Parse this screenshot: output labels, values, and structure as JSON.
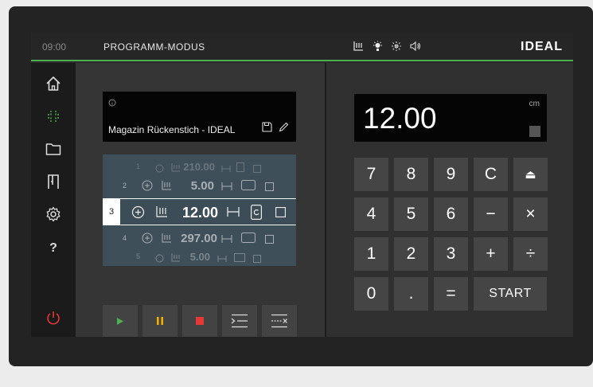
{
  "header": {
    "time": "09:00",
    "mode": "PROGRAMM-MODUS",
    "logo": "IDEAL"
  },
  "status_icons": [
    "cutting-table-icon",
    "light-icon",
    "air-table-icon",
    "sound-icon"
  ],
  "sidebar": {
    "items": [
      "home-icon",
      "program-mode-icon",
      "folder-icon",
      "manual-mode-icon",
      "settings-icon"
    ],
    "help": "?",
    "power": "power-icon"
  },
  "program": {
    "name": "Magazin Rückenstich - IDEAL"
  },
  "steps": [
    {
      "num": "1",
      "value": "210.00"
    },
    {
      "num": "2",
      "value": "5.00"
    },
    {
      "num": "3",
      "value": "12.00",
      "selected": true
    },
    {
      "num": "4",
      "value": "297.00"
    },
    {
      "num": "5",
      "value": "5.00"
    }
  ],
  "controls": [
    "play-icon",
    "pause-icon",
    "stop-icon",
    "insert-step-icon",
    "delete-step-icon"
  ],
  "display": {
    "value": "12.00",
    "unit": "cm"
  },
  "keypad": {
    "k7": "7",
    "k8": "8",
    "k9": "9",
    "clear": "C",
    "eject": "⏏",
    "k4": "4",
    "k5": "5",
    "k6": "6",
    "minus": "−",
    "times": "×",
    "k1": "1",
    "k2": "2",
    "k3": "3",
    "plus": "+",
    "divide": "÷",
    "k0": "0",
    "dot": ".",
    "equals": "=",
    "start": "START"
  },
  "colors": {
    "accent_green": "#4caf50",
    "play": "#4caf50",
    "pause": "#f0b000",
    "stop": "#e53935",
    "power": "#e53935"
  }
}
